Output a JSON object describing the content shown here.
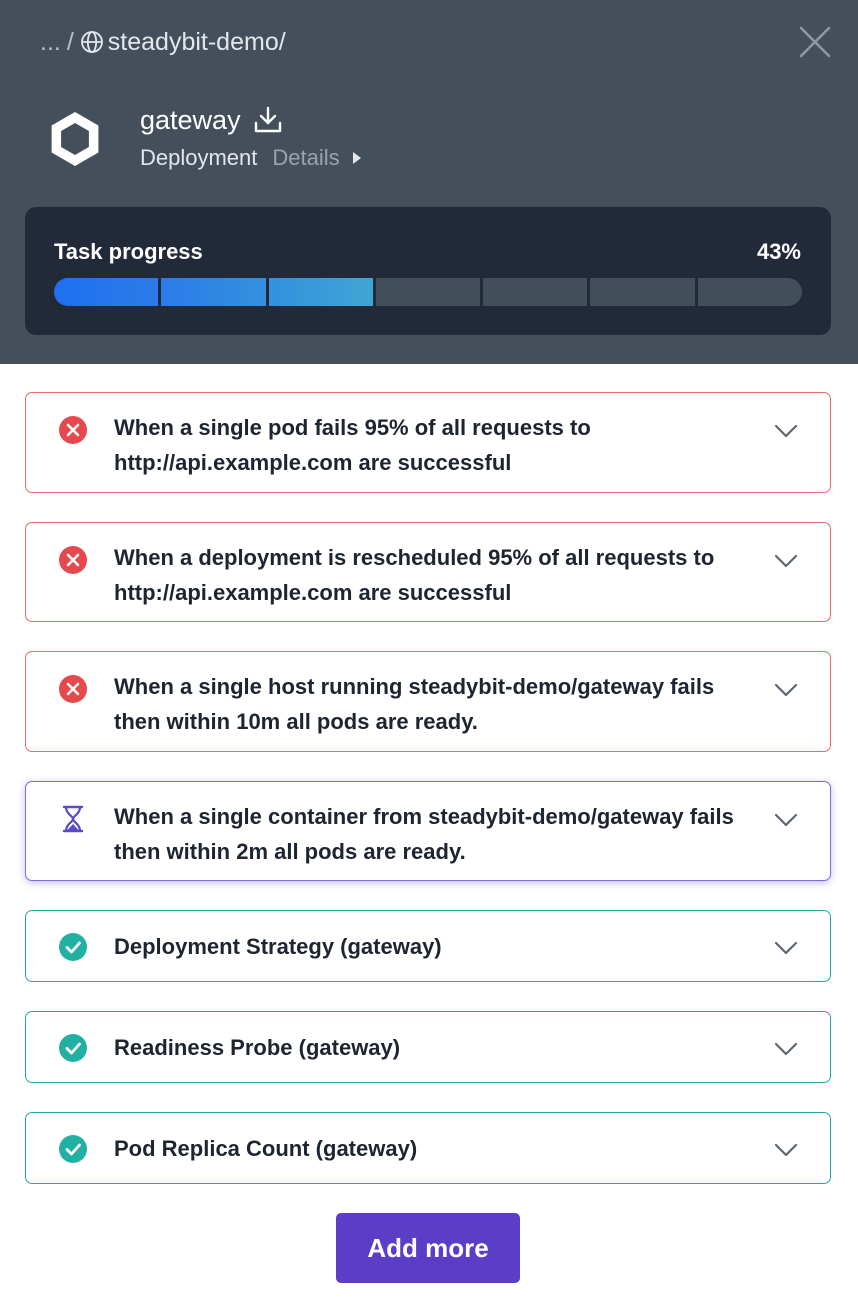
{
  "breadcrumb": {
    "ellipsis": "...",
    "separator": "/",
    "namespace": "steadybit-demo/"
  },
  "header": {
    "title": "gateway",
    "type": "Deployment",
    "details_link": "Details"
  },
  "progress": {
    "label": "Task progress",
    "percent_text": "43%",
    "percent": 43,
    "segments_total": 7,
    "segments_filled": 3
  },
  "checks": [
    {
      "status": "failed",
      "icon": "x-circle-icon",
      "text": "When a single pod fails 95% of all requests to http://api.example.com are successful"
    },
    {
      "status": "failed",
      "icon": "x-circle-icon",
      "text": "When a deployment is rescheduled 95% of all requests to http://api.example.com are successful"
    },
    {
      "status": "failed",
      "icon": "x-circle-icon",
      "text": "When a single host running steadybit-demo/gateway fails then within 10m all pods are ready."
    },
    {
      "status": "running",
      "icon": "hourglass-icon",
      "text": "When a single container from steadybit-demo/gateway fails then within 2m all pods are ready."
    },
    {
      "status": "passed",
      "icon": "check-circle-icon",
      "text": "Deployment Strategy (gateway)"
    },
    {
      "status": "passed",
      "icon": "check-circle-icon",
      "text": "Readiness Probe (gateway)"
    },
    {
      "status": "passed",
      "icon": "check-circle-icon",
      "text": "Pod Replica Count (gateway)"
    }
  ],
  "actions": {
    "add_more": "Add more"
  },
  "colors": {
    "header_bg": "#444f5b",
    "progress_card_bg": "#222938",
    "failed": "#e5484d",
    "running": "#5b4bc4",
    "passed": "#22b0a3",
    "primary_button": "#5a3ec8"
  }
}
